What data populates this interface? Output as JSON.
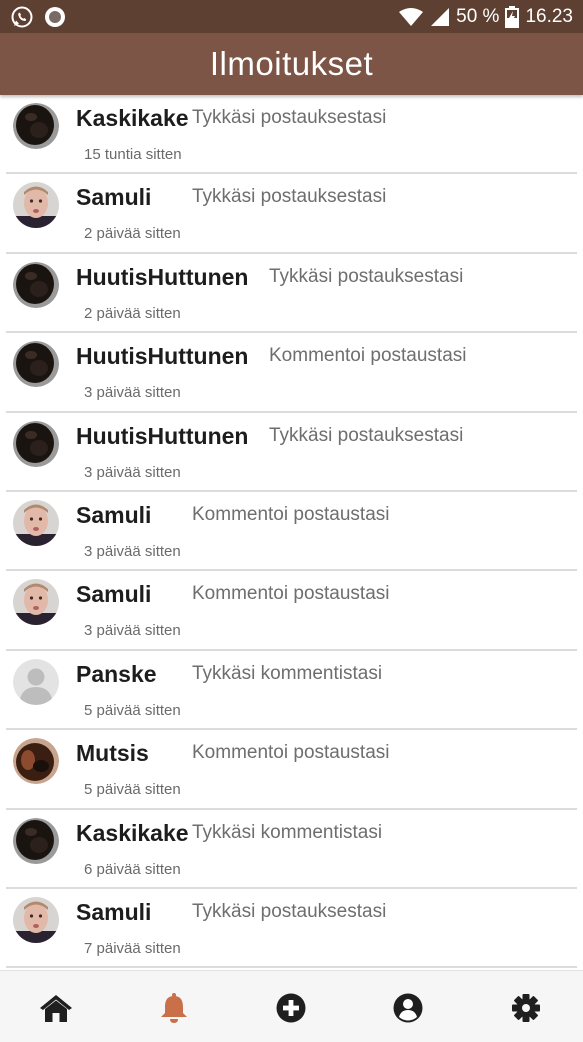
{
  "status_bar": {
    "battery_percent": "50 %",
    "time": "16.23",
    "icons": [
      "whatsapp-icon",
      "notification-dot-icon",
      "wifi-icon",
      "signal-icon",
      "battery-icon"
    ]
  },
  "header": {
    "title": "Ilmoitukset"
  },
  "notifications": [
    {
      "user": "Kaskikake",
      "action": "Tykkäsi postauksestasi",
      "time": "15 tuntia sitten",
      "avatar": "dark"
    },
    {
      "user": "Samuli",
      "action": "Tykkäsi postauksestasi",
      "time": "2 päivää sitten",
      "avatar": "face"
    },
    {
      "user": "HuutisHuttunen",
      "action": "Tykkäsi postauksestasi",
      "time": "2 päivää sitten",
      "avatar": "dark"
    },
    {
      "user": "HuutisHuttunen",
      "action": "Kommentoi postaustasi",
      "time": "3 päivää sitten",
      "avatar": "dark"
    },
    {
      "user": "HuutisHuttunen",
      "action": "Tykkäsi postauksestasi",
      "time": "3 päivää sitten",
      "avatar": "dark"
    },
    {
      "user": "Samuli",
      "action": "Kommentoi postaustasi",
      "time": "3 päivää sitten",
      "avatar": "face"
    },
    {
      "user": "Samuli",
      "action": "Kommentoi postaustasi",
      "time": "3 päivää sitten",
      "avatar": "face"
    },
    {
      "user": "Panske",
      "action": "Tykkäsi kommentistasi",
      "time": "5 päivää sitten",
      "avatar": "default"
    },
    {
      "user": "Mutsis",
      "action": "Kommentoi postaustasi",
      "time": "5 päivää sitten",
      "avatar": "brown"
    },
    {
      "user": "Kaskikake",
      "action": "Tykkäsi kommentistasi",
      "time": "6 päivää sitten",
      "avatar": "dark"
    },
    {
      "user": "Samuli",
      "action": "Tykkäsi postauksestasi",
      "time": "7 päivää sitten",
      "avatar": "face"
    }
  ],
  "bottom_nav": {
    "items": [
      {
        "name": "home",
        "icon": "home-icon",
        "active": false
      },
      {
        "name": "notifications",
        "icon": "bell-icon",
        "active": true
      },
      {
        "name": "add-post",
        "icon": "plus-circle-icon",
        "active": false
      },
      {
        "name": "profile",
        "icon": "user-circle-icon",
        "active": false
      },
      {
        "name": "settings",
        "icon": "gear-icon",
        "active": false
      }
    ],
    "active_color": "#c96f4a",
    "inactive_color": "#1f1f1f"
  },
  "colors": {
    "status_bar": "#5e4032",
    "header": "#7d5546",
    "username": "#1d1d1d",
    "action_text": "#6e6e6e",
    "divider": "#dcdcdc"
  }
}
